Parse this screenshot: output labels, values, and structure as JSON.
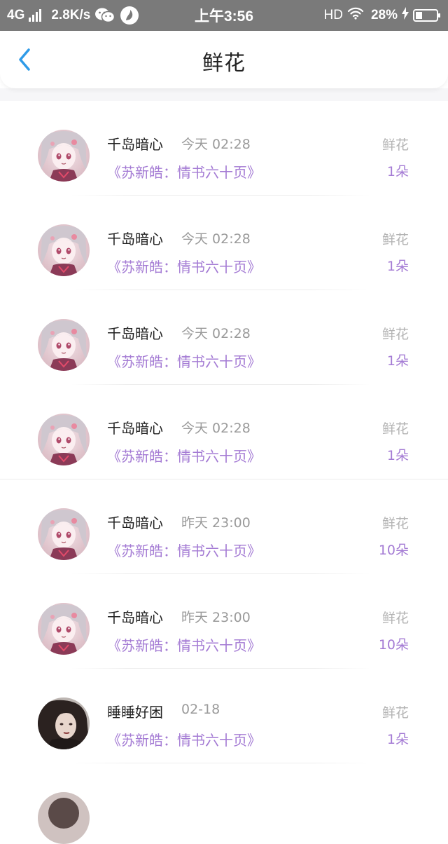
{
  "status_bar": {
    "network": "4G",
    "speed": "2.8K/s",
    "time": "上午3:56",
    "hd": "HD",
    "battery": "28%"
  },
  "header": {
    "title": "鲜花",
    "back_icon": "chevron-left-icon"
  },
  "colors": {
    "accent": "#2f9be8",
    "link_purple": "#a47bd4",
    "status_bar": "#7a7a7a"
  },
  "records": [
    {
      "user": "千岛暗心",
      "time": "今天 02:28",
      "book": "《苏新皓：情书六十页》",
      "gift": "鲜花",
      "count": "1朵",
      "avatar": "anime-girl-avatar"
    },
    {
      "user": "千岛暗心",
      "time": "今天 02:28",
      "book": "《苏新皓：情书六十页》",
      "gift": "鲜花",
      "count": "1朵",
      "avatar": "anime-girl-avatar"
    },
    {
      "user": "千岛暗心",
      "time": "今天 02:28",
      "book": "《苏新皓：情书六十页》",
      "gift": "鲜花",
      "count": "1朵",
      "avatar": "anime-girl-avatar"
    },
    {
      "user": "千岛暗心",
      "time": "今天 02:28",
      "book": "《苏新皓：情书六十页》",
      "gift": "鲜花",
      "count": "1朵",
      "avatar": "anime-girl-avatar"
    },
    {
      "user": "千岛暗心",
      "time": "昨天 23:00",
      "book": "《苏新皓：情书六十页》",
      "gift": "鲜花",
      "count": "10朵",
      "avatar": "anime-girl-avatar"
    },
    {
      "user": "千岛暗心",
      "time": "昨天 23:00",
      "book": "《苏新皓：情书六十页》",
      "gift": "鲜花",
      "count": "10朵",
      "avatar": "anime-girl-avatar"
    },
    {
      "user": "睡睡好困",
      "time": "02-18",
      "book": "《苏新皓：情书六十页》",
      "gift": "鲜花",
      "count": "1朵",
      "avatar": "dark-hair-girl-avatar"
    }
  ]
}
